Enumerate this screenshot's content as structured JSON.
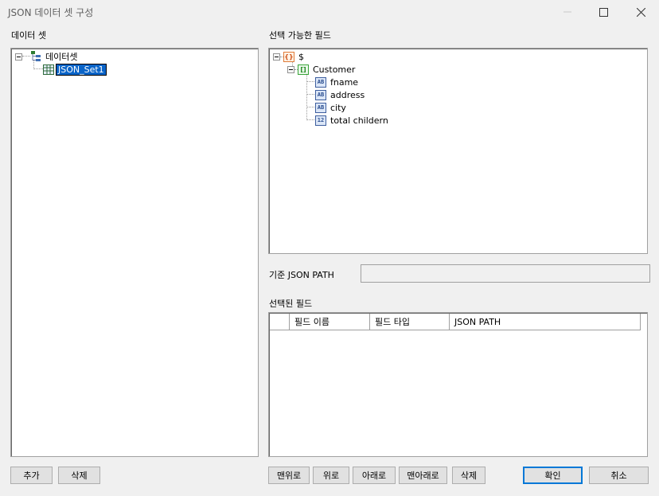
{
  "window": {
    "title": "JSON 데이터 셋 구성"
  },
  "left": {
    "label": "데이터 셋",
    "tree": {
      "root": "데이터셋",
      "child": "JSON_Set1"
    },
    "buttons": {
      "add": "추가",
      "delete": "삭제"
    }
  },
  "right": {
    "fields_label": "선택 가능한 필드",
    "tree": {
      "root": "$",
      "root_icon": "{}",
      "array": "Customer",
      "array_icon": "[]",
      "fields": [
        {
          "name": "fname",
          "icon": "AB"
        },
        {
          "name": "address",
          "icon": "AB"
        },
        {
          "name": "city",
          "icon": "AB"
        },
        {
          "name": "total childern",
          "icon": "12"
        }
      ]
    },
    "json_path_label": "기준 JSON PATH",
    "json_path_value": "",
    "selected_label": "선택된 필드",
    "grid_columns": [
      "필드 이름",
      "필드 타입",
      "JSON PATH"
    ],
    "buttons": {
      "top": "맨위로",
      "up": "위로",
      "down": "아래로",
      "bottom": "맨아래로",
      "delete": "삭제",
      "ok": "확인",
      "cancel": "취소"
    }
  }
}
